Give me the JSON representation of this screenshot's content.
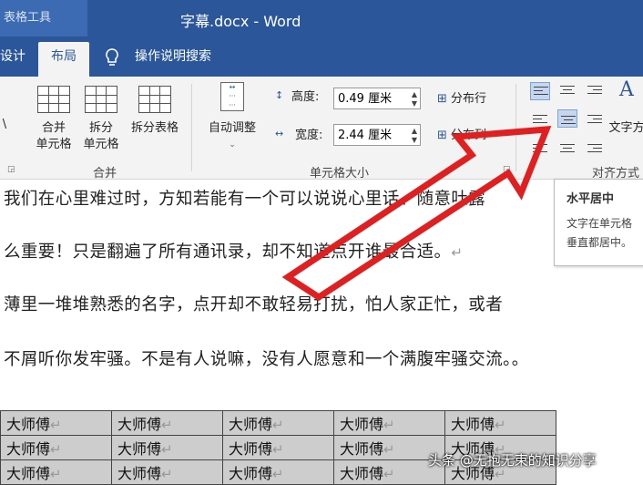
{
  "titlebar": {
    "table_tools": "表格工具",
    "doc_title": "字幕.docx  -  Word",
    "tabs": [
      "设计",
      "布局"
    ],
    "tell_me": "操作说明搜索"
  },
  "ribbon": {
    "merge": {
      "label": "合并",
      "buttons": [
        "合并\n单元格",
        "拆分\n单元格",
        "拆分表格"
      ]
    },
    "cellsize": {
      "label": "单元格大小",
      "autofit": "自动调整",
      "height_label": "高度:",
      "height_value": "0.49 厘米",
      "width_label": "宽度:",
      "width_value": "2.44 厘米",
      "distribute_rows": "分布行",
      "distribute_cols": "分布列"
    },
    "alignment": {
      "label": "对齐方式",
      "text_direction": "文字方"
    },
    "left_cut": "\\"
  },
  "tooltip": {
    "title": "水平居中",
    "desc_line1": "文字在单元格",
    "desc_line2": "垂直都居中。"
  },
  "document": {
    "lines": [
      "我们在心里难过时，方知若能有一个可以说说心里话、随意吐露",
      "么重要！只是翻遍了所有通讯录，却不知道点开谁最合适。",
      "薄里一堆堆熟悉的名字，点开却不敢轻易打扰，怕人家正忙，或者",
      "不屑听你发牢骚。不是有人说嘛，没有人愿意和一个满腹牢骚交流。。"
    ],
    "paragraph_mark": "↵",
    "table_rows": [
      [
        "大师傅",
        "大师傅",
        "大师傅",
        "大师傅",
        "大师傅"
      ],
      [
        "大师傅",
        "大师傅",
        "大师傅",
        "大师傅",
        "大师傅"
      ],
      [
        "大师傅",
        "大师傅",
        "大师傅",
        "大师傅",
        "大师傅"
      ]
    ]
  },
  "watermark": "头条 @无抱无束的知识分享",
  "colors": {
    "title_blue": "#2b579a",
    "arrow_red": "#e02020"
  }
}
